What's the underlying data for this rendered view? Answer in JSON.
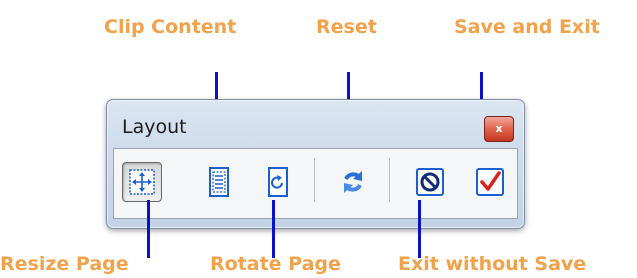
{
  "palette": {
    "title": "Layout",
    "close_glyph": "x"
  },
  "callouts": {
    "clip_content": "Clip Content",
    "reset": "Reset",
    "save_and_exit": "Save and Exit",
    "resize_page": "Resize Page",
    "rotate_page": "Rotate Page",
    "exit_without_save": "Exit without Save"
  },
  "tools": [
    {
      "name": "resize-page",
      "icon": "resize-arrows-icon",
      "selected": true
    },
    {
      "name": "clip-content",
      "icon": "clip-content-icon",
      "selected": false
    },
    {
      "name": "rotate-page",
      "icon": "rotate-icon",
      "selected": false
    },
    {
      "name": "reset",
      "icon": "reset-icon",
      "selected": false
    },
    {
      "name": "exit-without-save",
      "icon": "cancel-icon",
      "selected": false
    },
    {
      "name": "save-and-exit",
      "icon": "check-icon",
      "selected": false
    }
  ],
  "colors": {
    "callout_text": "#f2a24a",
    "leader_line": "#0a12c8",
    "icon_blue": "#1b5fd0",
    "check_red": "#d8231c"
  }
}
